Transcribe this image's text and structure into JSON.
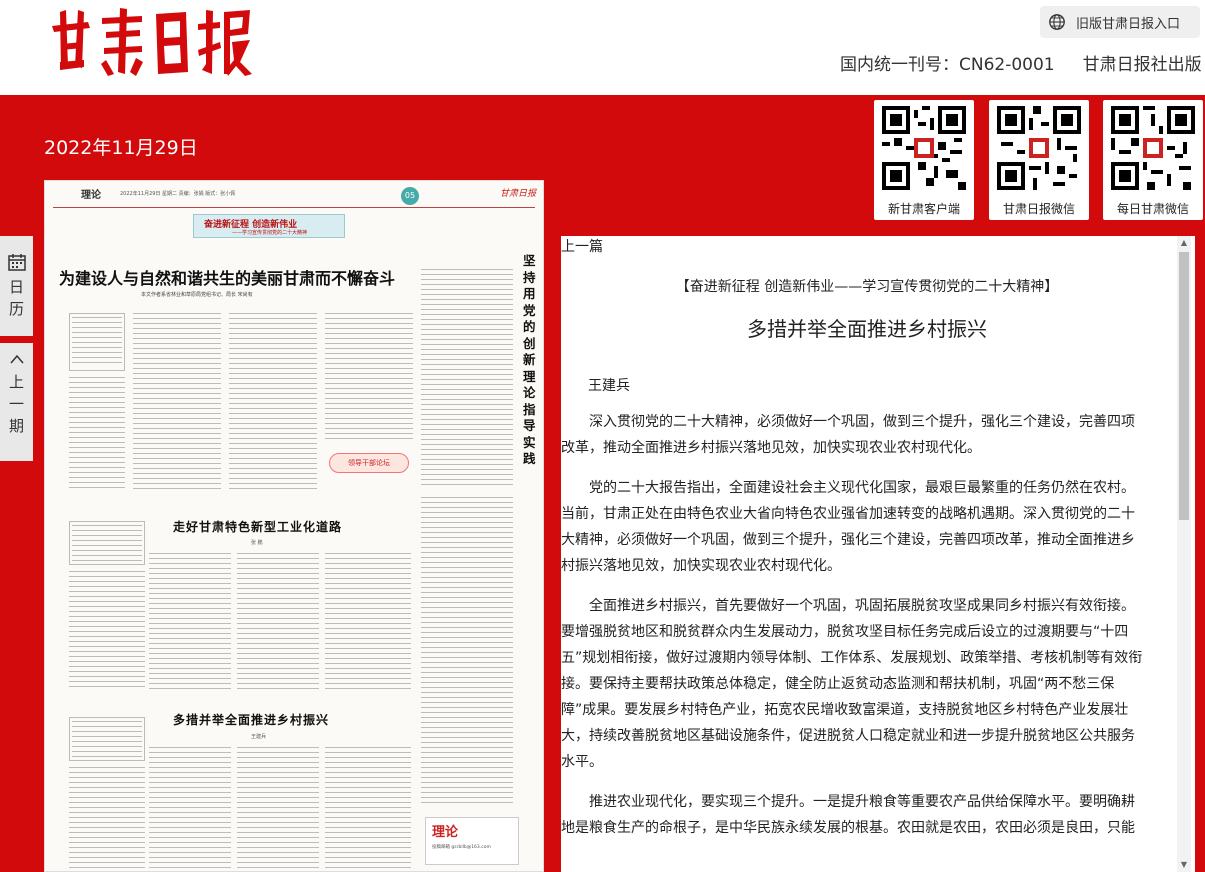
{
  "header": {
    "logo_text": "甘肃日报",
    "old_version_link": "旧版甘肃日报入口",
    "issn": "国内统一刊号：CN62-0001",
    "publisher": "甘肃日报社出版"
  },
  "date": "2022年11月29日",
  "qr_codes": [
    {
      "caption": "新甘肃客户端"
    },
    {
      "caption": "甘肃日报微信"
    },
    {
      "caption": "每日甘肃微信"
    }
  ],
  "side_tabs": {
    "calendar": "日历",
    "prev_issue": "上一期"
  },
  "newspaper": {
    "section": "理论",
    "meta": "2022年11月29日  星期二  责编：张娟  版式：张小佩",
    "page_number": "05",
    "masthead": "甘肃日报",
    "banner_main": "奋进新征程 创造新伟业",
    "banner_sub": "——学习宣传贯彻党的二十大精神",
    "headline_1": "为建设人与自然和谐共生的美丽甘肃而不懈奋斗",
    "byline_1": "本文作者系省林业和草原局党组书记、局长  宋尚有",
    "headline_2": "走好甘肃特色新型工业化道路",
    "byline_2": "张 鹏",
    "headline_3": "多措并举全面推进乡村振兴",
    "byline_3": "王建兵",
    "vertical_headline": "坚持用党的创新理论指导实践",
    "column_tag": "领导干部论坛",
    "logo_block_title": "理论",
    "logo_block_sub": "投稿邮箱 gsrbllb@163.com"
  },
  "article": {
    "prev_link": "上一篇",
    "kicker": "【奋进新征程 创造新伟业——学习宣传贯彻党的二十大精神】",
    "title": "多措并举全面推进乡村振兴",
    "author": "王建兵",
    "paragraphs": [
      "深入贯彻党的二十大精神，必须做好一个巩固，做到三个提升，强化三个建设，完善四项改革，推动全面推进乡村振兴落地见效，加快实现农业农村现代化。",
      "党的二十大报告指出，全面建设社会主义现代化国家，最艰巨最繁重的任务仍然在农村。当前，甘肃正处在由特色农业大省向特色农业强省加速转变的战略机遇期。深入贯彻党的二十大精神，必须做好一个巩固，做到三个提升，强化三个建设，完善四项改革，推动全面推进乡村振兴落地见效，加快实现农业农村现代化。",
      "全面推进乡村振兴，首先要做好一个巩固，巩固拓展脱贫攻坚成果同乡村振兴有效衔接。要增强脱贫地区和脱贫群众内生发展动力，脱贫攻坚目标任务完成后设立的过渡期要与“十四五”规划相衔接，做好过渡期内领导体制、工作体系、发展规划、政策举措、考核机制等有效衔接。要保持主要帮扶政策总体稳定，健全防止返贫动态监测和帮扶机制，巩固“两不愁三保障”成果。要发展乡村特色产业，拓宽农民增收致富渠道，支持脱贫地区乡村特色产业发展壮大，持续改善脱贫地区基础设施条件，促进脱贫人口稳定就业和进一步提升脱贫地区公共服务水平。",
      "推进农业现代化，要实现三个提升。一是提升粮食等重要农产品供给保障水平。要明确耕地是粮食生产的命根子，是中华民族永续发展的根基。农田就是农田，农田必须是良田，只能"
    ]
  }
}
